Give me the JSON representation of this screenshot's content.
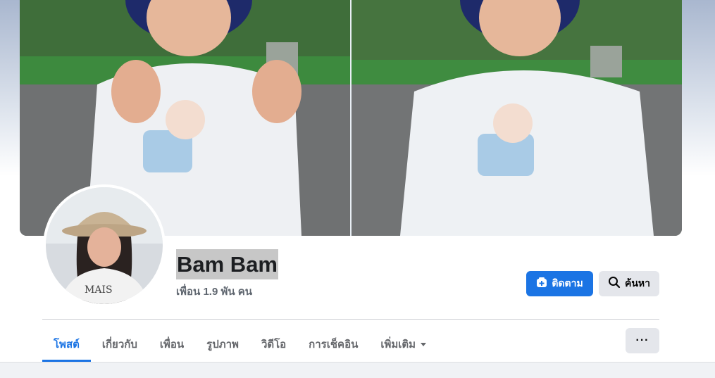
{
  "profile": {
    "name": "Bam Bam",
    "friends": "เพื่อน 1.9 พัน คน"
  },
  "actions": {
    "follow_label": "ติดตาม",
    "search_label": "ค้นหา"
  },
  "tabs": [
    {
      "label": "โพสต์"
    },
    {
      "label": "เกี่ยวกับ"
    },
    {
      "label": "เพื่อน"
    },
    {
      "label": "รูปภาพ"
    },
    {
      "label": "วิดีโอ"
    },
    {
      "label": "การเช็คอิน"
    },
    {
      "label": "เพิ่มเติม"
    }
  ],
  "more_options_label": "···",
  "icons": {
    "follow": "follow-plus-icon",
    "search": "magnifier-icon",
    "dropdown": "caret-down-icon"
  },
  "colors": {
    "accent": "#1b74e4",
    "secondary_button": "#e4e6eb"
  }
}
